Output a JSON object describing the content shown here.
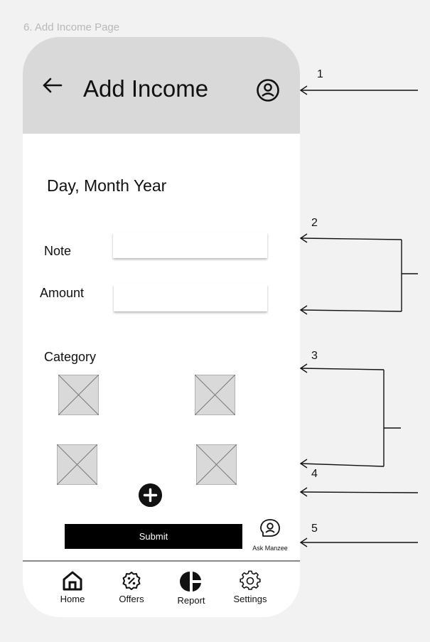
{
  "frame_label": "6. Add Income Page",
  "header": {
    "title": "Add Income",
    "back_icon": "arrow-left-icon",
    "profile_icon": "user-circle-icon"
  },
  "date_text": "Day, Month Year",
  "form": {
    "note_label": "Note",
    "note_value": "",
    "amount_label": "Amount",
    "amount_value": ""
  },
  "category": {
    "label": "Category",
    "tiles": [
      "image-placeholder-icon",
      "image-placeholder-icon",
      "image-placeholder-icon",
      "image-placeholder-icon"
    ],
    "add_icon": "plus-circle-icon"
  },
  "submit_label": "Submit",
  "assistant": {
    "label": "Ask Manzee",
    "icon": "assistant-chat-icon"
  },
  "bottom_nav": [
    {
      "label": "Home",
      "icon": "home-icon"
    },
    {
      "label": "Offers",
      "icon": "discount-badge-icon"
    },
    {
      "label": "Report",
      "icon": "pie-chart-icon"
    },
    {
      "label": "Settings",
      "icon": "gear-icon"
    }
  ],
  "callouts": [
    "1",
    "2",
    "3",
    "4",
    "5"
  ],
  "colors": {
    "header_bg": "#d9d9d9",
    "page_bg": "#f2f2f2",
    "button_bg": "#000000",
    "placeholder_bg": "#d9d9d9"
  }
}
